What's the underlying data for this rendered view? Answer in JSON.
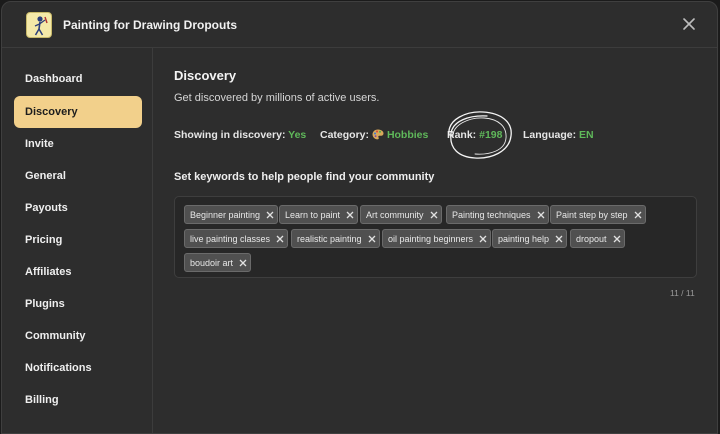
{
  "app": {
    "title": "Painting for Drawing Dropouts"
  },
  "sidebar": {
    "items": [
      {
        "label": "Dashboard",
        "active": false
      },
      {
        "label": "Discovery",
        "active": true
      },
      {
        "label": "Invite",
        "active": false
      },
      {
        "label": "General",
        "active": false
      },
      {
        "label": "Payouts",
        "active": false
      },
      {
        "label": "Pricing",
        "active": false
      },
      {
        "label": "Affiliates",
        "active": false
      },
      {
        "label": "Plugins",
        "active": false
      },
      {
        "label": "Community",
        "active": false
      },
      {
        "label": "Notifications",
        "active": false
      },
      {
        "label": "Billing",
        "active": false
      }
    ]
  },
  "main": {
    "title": "Discovery",
    "subtitle": "Get discovered by millions of active users.",
    "stats": {
      "showing_label": "Showing in discovery:",
      "showing_value": "Yes",
      "category_label": "Category:",
      "category_icon": "palette-icon",
      "category_value": "Hobbies",
      "rank_label": "Rank:",
      "rank_value": "#198",
      "language_label": "Language:",
      "language_value": "EN"
    },
    "keywords_label": "Set keywords to help people find your community",
    "keywords": [
      "Beginner painting",
      "Learn to paint",
      "Art community",
      "Painting techniques",
      "Paint step by step",
      "live painting classes",
      "realistic painting",
      "oil painting beginners",
      "painting help",
      "dropout",
      "boudoir art"
    ],
    "keyword_counter": "11 / 11"
  },
  "colors": {
    "accent": "#f2d08b",
    "green": "#5fb85a",
    "background": "#2d2d2d"
  }
}
